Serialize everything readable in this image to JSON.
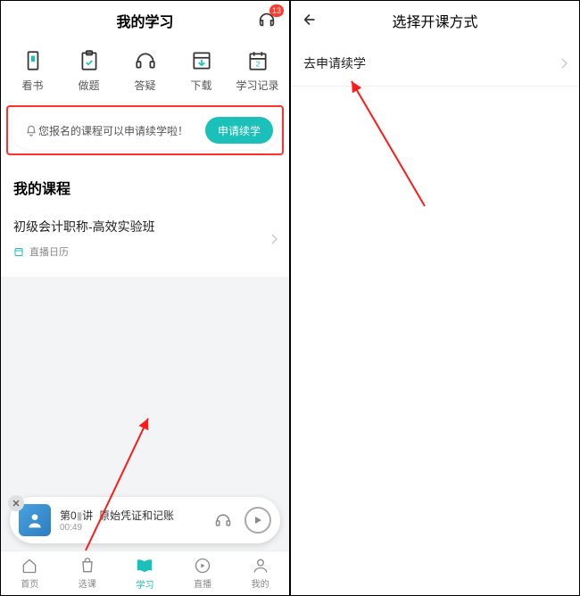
{
  "left": {
    "header": {
      "title": "我的学习",
      "badge_count": "13"
    },
    "nav": [
      {
        "label": "看书",
        "icon": "book-icon"
      },
      {
        "label": "做题",
        "icon": "clipboard-icon"
      },
      {
        "label": "答疑",
        "icon": "headphones-icon"
      },
      {
        "label": "下载",
        "icon": "download-icon"
      },
      {
        "label": "学习记录",
        "icon": "calendar-icon"
      }
    ],
    "banner": {
      "text": "您报名的课程可以申请续学啦！",
      "button": "申请续学"
    },
    "section_title": "我的课程",
    "course": {
      "name": "初级会计职称-高效实验班",
      "sub_label": "直播日历"
    },
    "player": {
      "title_prefix": "第0",
      "title_mid": "讲",
      "title_suffix": "原始凭证和记账",
      "time": "00:49"
    },
    "tabs": [
      {
        "label": "首页",
        "icon": "home-icon"
      },
      {
        "label": "选课",
        "icon": "bag-icon"
      },
      {
        "label": "学习",
        "icon": "open-book-icon",
        "active": true
      },
      {
        "label": "直播",
        "icon": "play-circle-icon"
      },
      {
        "label": "我的",
        "icon": "person-icon"
      }
    ]
  },
  "right": {
    "title": "选择开课方式",
    "row": {
      "label": "去申请续学"
    }
  }
}
